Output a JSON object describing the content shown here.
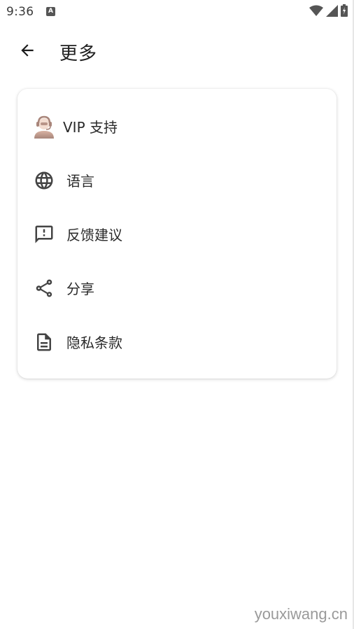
{
  "status_bar": {
    "time": "9:36",
    "notification_icon": "a-notification-icon",
    "icons": [
      "wifi-icon",
      "signal-icon",
      "battery-icon"
    ]
  },
  "app_bar": {
    "back_icon": "arrow-left-icon",
    "title": "更多"
  },
  "menu": {
    "items": [
      {
        "icon": "customer-service-avatar-icon",
        "label": "VIP 支持"
      },
      {
        "icon": "globe-icon",
        "label": "语言"
      },
      {
        "icon": "feedback-icon",
        "label": "反馈建议"
      },
      {
        "icon": "share-icon",
        "label": "分享"
      },
      {
        "icon": "document-icon",
        "label": "隐私条款"
      }
    ]
  },
  "watermark": "youxiwang.cn",
  "colors": {
    "background": "#ffffff",
    "icon": "#444444",
    "text": "#2a2a2a"
  }
}
